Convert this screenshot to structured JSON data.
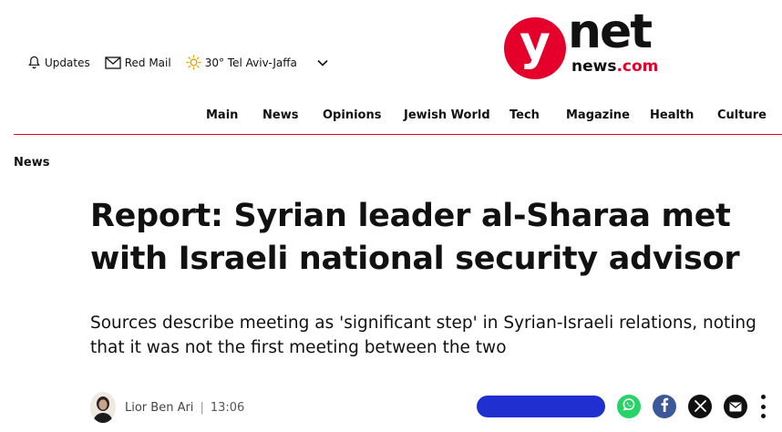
{
  "utility": {
    "updates_label": "Updates",
    "mail_label": "Red Mail",
    "weather_label": "30° Tel Aviv-Jaffa"
  },
  "logo": {
    "y": "y",
    "net": "net",
    "news": "news",
    "dotcom": ".com",
    "accent_color": "#e4002b"
  },
  "nav": {
    "items": [
      "Main",
      "News",
      "Opinions",
      "Jewish World",
      "Tech",
      "Magazine",
      "Health",
      "Culture"
    ]
  },
  "breadcrumb": {
    "section": "News"
  },
  "article": {
    "headline": "Report: Syrian leader al-Sharaa met with Israeli national security advisor",
    "subheadline": "Sources describe meeting as 'significant step' in Syrian-Israeli relations, noting that it was not the first meeting between the two",
    "author": "Lior Ben Ari",
    "separator": "|",
    "time": "13:06"
  },
  "share": {
    "icons": [
      "whatsapp-icon",
      "facebook-icon",
      "x-icon",
      "mail-icon",
      "more-options-icon"
    ],
    "colors": {
      "whatsapp": "#25d366",
      "facebook": "#3b5998",
      "pill": "#1f2fd0"
    }
  }
}
